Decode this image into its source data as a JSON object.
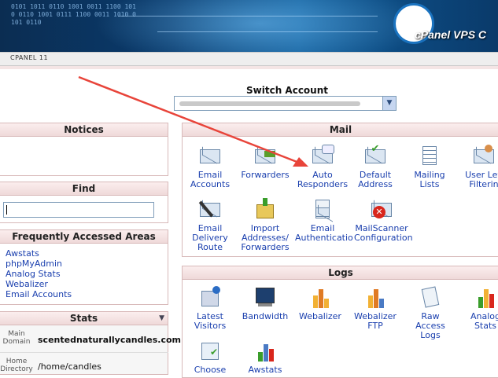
{
  "banner": {
    "brand": "cPanel VPS C"
  },
  "topbar": {
    "label": "CPANEL 11"
  },
  "switch_account": {
    "label": "Switch Account",
    "selected": ""
  },
  "notices": {
    "title": "Notices"
  },
  "find": {
    "title": "Find",
    "value": ""
  },
  "faa": {
    "title": "Frequently Accessed Areas",
    "links": [
      "Awstats",
      "phpMyAdmin",
      "Analog Stats",
      "Webalizer",
      "Email Accounts"
    ]
  },
  "stats": {
    "title": "Stats",
    "rows": [
      {
        "label": "Main Domain",
        "value": "scentednaturallycandles.com"
      },
      {
        "label": "Home Directory",
        "value": "/home/candles"
      }
    ]
  },
  "mail": {
    "title": "Mail",
    "items": [
      {
        "label": "Email\nAccounts",
        "icon": "email-accounts-icon"
      },
      {
        "label": "Forwarders",
        "icon": "forwarders-icon"
      },
      {
        "label": "Auto\nResponders",
        "icon": "auto-responders-icon"
      },
      {
        "label": "Default\nAddress",
        "icon": "default-address-icon"
      },
      {
        "label": "Mailing\nLists",
        "icon": "mailing-lists-icon"
      },
      {
        "label": "User Lev\nFilterin",
        "icon": "user-level-filtering-icon"
      },
      {
        "label": "Email\nDelivery\nRoute",
        "icon": "email-delivery-route-icon"
      },
      {
        "label": "Import\nAddresses/\nForwarders",
        "icon": "import-addresses-icon"
      },
      {
        "label": "Email\nAuthenticatio",
        "icon": "email-authentication-icon"
      },
      {
        "label": "MailScanner\nConfiguration",
        "icon": "mailscanner-icon"
      }
    ]
  },
  "logs": {
    "title": "Logs",
    "items": [
      {
        "label": "Latest\nVisitors",
        "icon": "latest-visitors-icon"
      },
      {
        "label": "Bandwidth",
        "icon": "bandwidth-icon"
      },
      {
        "label": "Webalizer",
        "icon": "webalizer-icon"
      },
      {
        "label": "Webalizer\nFTP",
        "icon": "webalizer-ftp-icon"
      },
      {
        "label": "Raw\nAccess\nLogs",
        "icon": "raw-access-logs-icon"
      },
      {
        "label": "Analog\nStats",
        "icon": "analog-stats-icon"
      },
      {
        "label": "Choose",
        "icon": "choose-log-programs-icon"
      },
      {
        "label": "Awstats",
        "icon": "awstats-icon"
      }
    ]
  },
  "colors": {
    "link": "#1a3fae",
    "panel_header": "#efd9d9",
    "annotation_arrow": "#e8443a"
  }
}
